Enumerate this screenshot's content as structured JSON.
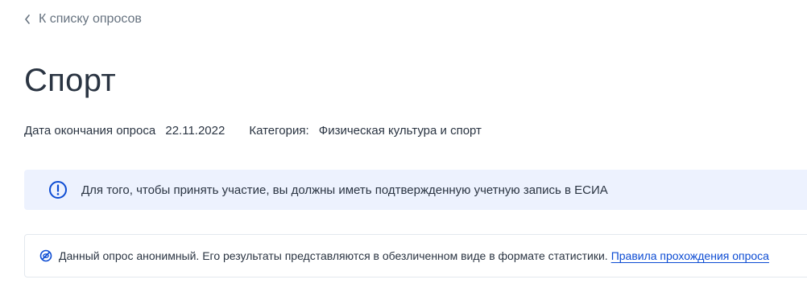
{
  "nav": {
    "back_label": "К списку опросов"
  },
  "page": {
    "title": "Спорт"
  },
  "meta": {
    "end_date_label": "Дата окончания опроса",
    "end_date_value": "22.11.2022",
    "category_label": "Категория:",
    "category_value": "Физическая культура и спорт"
  },
  "alert": {
    "icon": "exclamation-circle-icon",
    "text": "Для того, чтобы принять участие, вы должны иметь подтвержденную учетную запись в ЕСИА"
  },
  "anonymity_notice": {
    "icon": "eye-off-icon",
    "text": "Данный опрос анонимный. Его результаты представляются в обезличенном виде в формате статистики.",
    "link_label": "Правила прохождения опроса"
  },
  "colors": {
    "accent": "#0d4cd3",
    "alert_bg": "#edf2fe",
    "text": "#2a3442",
    "muted": "#66727f"
  }
}
